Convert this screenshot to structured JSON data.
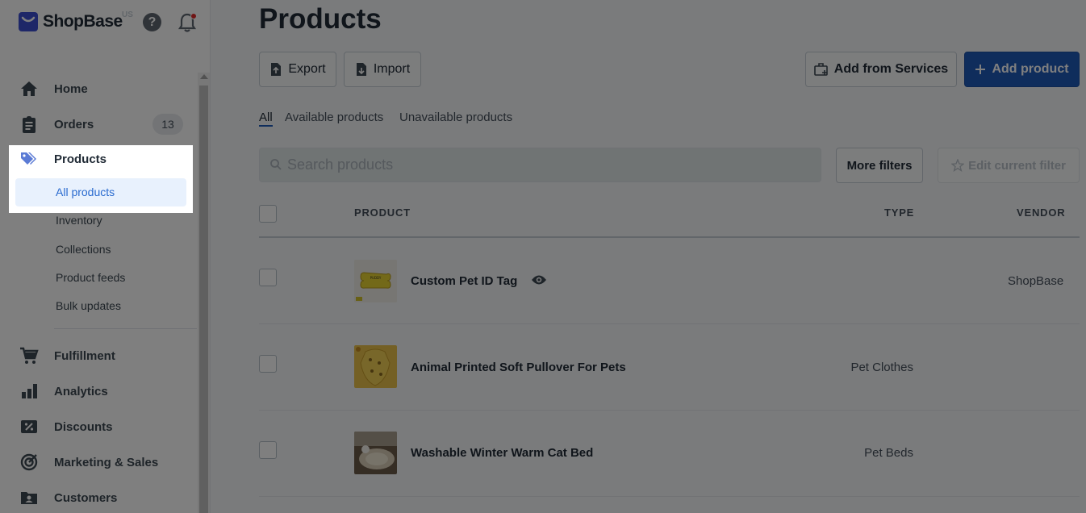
{
  "brand": {
    "name": "ShopBase",
    "region": "US"
  },
  "header": {
    "help": "?"
  },
  "sidebar": {
    "items": [
      {
        "label": "Home"
      },
      {
        "label": "Orders",
        "badge": "13"
      },
      {
        "label": "Products"
      },
      {
        "label": "Fulfillment"
      },
      {
        "label": "Analytics"
      },
      {
        "label": "Discounts"
      },
      {
        "label": "Marketing & Sales"
      },
      {
        "label": "Customers"
      }
    ],
    "products_sub": [
      "All products",
      "Inventory",
      "Collections",
      "Product feeds",
      "Bulk updates"
    ]
  },
  "page": {
    "title": "Products",
    "export_label": "Export",
    "import_label": "Import",
    "add_from_services_label": "Add from Services",
    "add_product_label": "Add product"
  },
  "tabs": [
    "All",
    "Available products",
    "Unavailable products"
  ],
  "search": {
    "placeholder": "Search products"
  },
  "filters": {
    "more_filters_label": "More filters",
    "edit_filter_label": "Edit current filter"
  },
  "table": {
    "headers": {
      "product": "PRODUCT",
      "type": "TYPE",
      "vendor": "VENDOR"
    },
    "rows": [
      {
        "name": "Custom Pet ID Tag",
        "type": "",
        "vendor": "ShopBase"
      },
      {
        "name": "Animal Printed Soft Pullover For Pets",
        "type": "Pet Clothes",
        "vendor": ""
      },
      {
        "name": "Washable Winter Warm Cat Bed",
        "type": "Pet Beds",
        "vendor": ""
      }
    ]
  },
  "colors": {
    "primary": "#1f5ab8",
    "active_sub_bg": "#e8f1fd",
    "active_sub_text": "#2a6bcf",
    "overlay": "rgba(0,0,0,0.5)"
  }
}
